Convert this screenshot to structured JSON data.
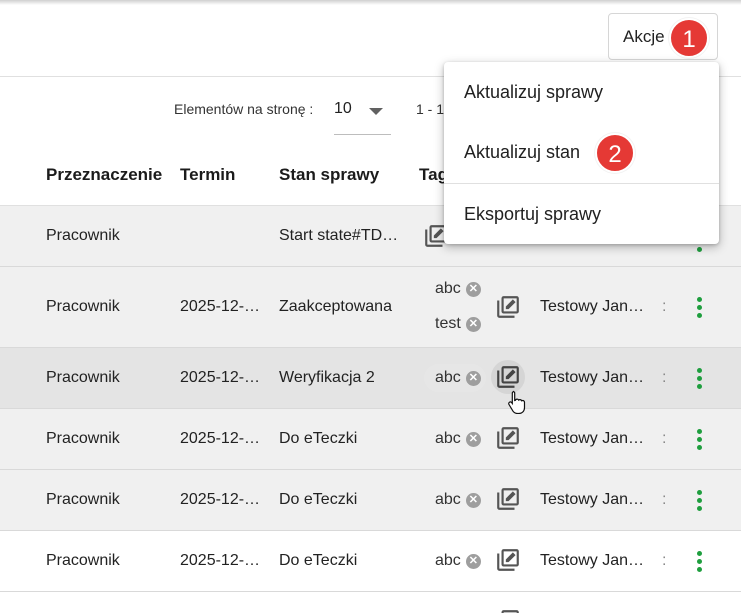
{
  "header": {
    "actions_label": "Akcje",
    "badge_1": "1",
    "badge_2": "2"
  },
  "menu": {
    "items": [
      "Aktualizuj sprawy",
      "Aktualizuj stan",
      "Eksportuj sprawy"
    ]
  },
  "paginator": {
    "items_per_page_label": "Elementów na stronę :",
    "items_per_page_value": "10",
    "range": "1 - 1"
  },
  "table": {
    "headers": [
      "Przeznaczenie",
      "Termin",
      "Stan sprawy",
      "Tag"
    ],
    "rows": [
      {
        "przeznaczenie": "Pracownik",
        "termin": "",
        "stan": "Start state#TD…",
        "tags": [],
        "osoba": ""
      },
      {
        "przeznaczenie": "Pracownik",
        "termin": "2025-12-…",
        "stan": "Zaakceptowana",
        "tags": [
          "abc",
          "test"
        ],
        "osoba": "Testowy Jan…"
      },
      {
        "przeznaczenie": "Pracownik",
        "termin": "2025-12-…",
        "stan": "Weryfikacja 2",
        "tags": [
          "abc"
        ],
        "osoba": "Testowy Jan…"
      },
      {
        "przeznaczenie": "Pracownik",
        "termin": "2025-12-…",
        "stan": "Do eTeczki",
        "tags": [
          "abc"
        ],
        "osoba": "Testowy Jan…"
      },
      {
        "przeznaczenie": "Pracownik",
        "termin": "2025-12-…",
        "stan": "Do eTeczki",
        "tags": [
          "abc"
        ],
        "osoba": "Testowy Jan…"
      },
      {
        "przeznaczenie": "Pracownik",
        "termin": "2025-12-…",
        "stan": "Do eTeczki",
        "tags": [
          "abc"
        ],
        "osoba": "Testowy Jan…"
      }
    ]
  },
  "icons": {
    "edit": "edit-tags-icon",
    "more": "more-vert-icon",
    "remove_tag": "remove-tag-icon",
    "cursor": "hand-pointer-icon"
  },
  "colors": {
    "badge": "#e53935",
    "kebab": "#1e9e3e",
    "row_alt": "#f0f0f0",
    "row_hover": "#e4e4e4"
  }
}
